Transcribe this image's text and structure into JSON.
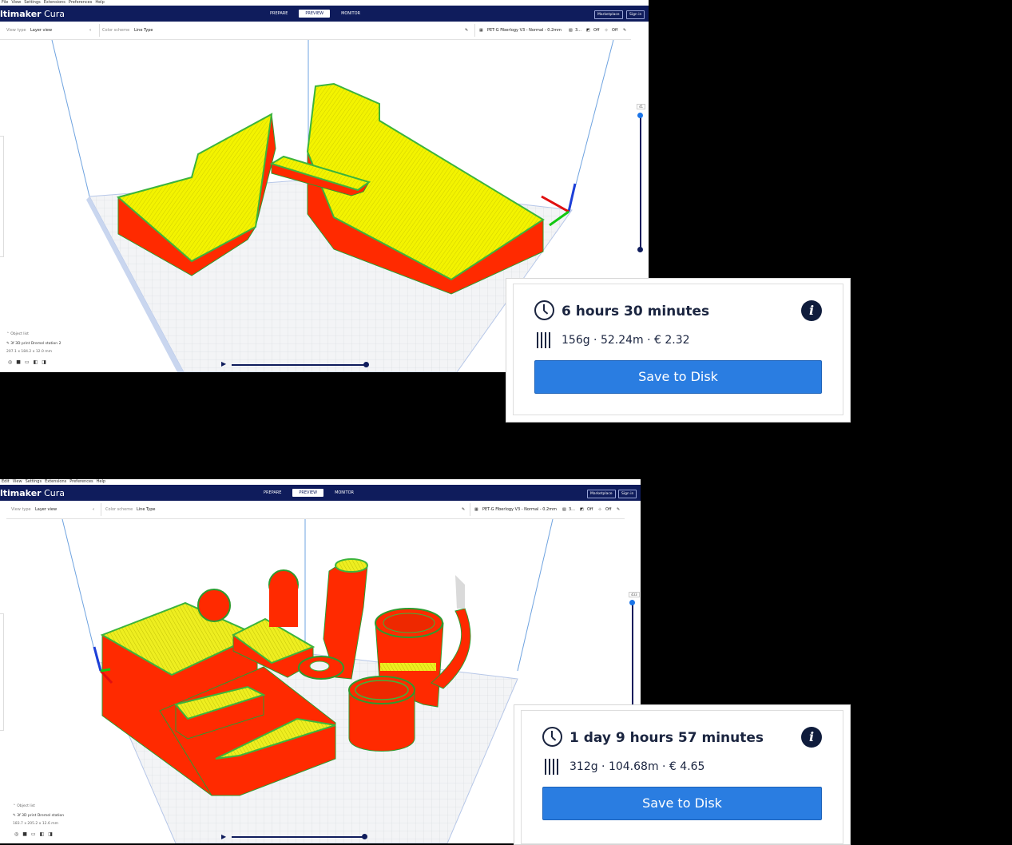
{
  "shots": [
    {
      "menu": [
        "File",
        "View",
        "Settings",
        "Extensions",
        "Preferences",
        "Help"
      ],
      "brand_bold": "ltimaker",
      "brand_rest": " Cura",
      "stages": [
        "PREPARE",
        "PREVIEW",
        "MONITOR"
      ],
      "active_stage": "PREVIEW",
      "marketplace_label": "Marketplace",
      "signin_label": "Sign in",
      "view_type_label": "View type",
      "view_type_value": "Layer view",
      "color_scheme_label": "Color scheme",
      "color_scheme_value": "Line Type",
      "print_setup": "PET-G Fiberlogy V3 - Normal - 0.2mm",
      "support_value": "3...",
      "adhesion1": "Off",
      "adhesion2": "Off",
      "layer_number": "41",
      "object_list_label": "Object list",
      "printer_name": "3f 3D print Dremel station 2",
      "dimensions": "207.1 x 184.2 x 12.0 mm"
    },
    {
      "menu": [
        "Edit",
        "View",
        "Settings",
        "Extensions",
        "Preferences",
        "Help"
      ],
      "brand_bold": "ltimaker",
      "brand_rest": " Cura",
      "stages": [
        "PREPARE",
        "PREVIEW",
        "MONITOR"
      ],
      "active_stage": "PREVIEW",
      "marketplace_label": "Marketplace",
      "signin_label": "Sign in",
      "view_type_label": "View type",
      "view_type_value": "Layer view",
      "color_scheme_label": "Color scheme",
      "color_scheme_value": "Line Type",
      "print_setup": "PET-G Fiberlogy V3 - Normal - 0.2mm",
      "support_value": "3...",
      "adhesion1": "Off",
      "adhesion2": "Off",
      "layer_number": "433",
      "object_list_label": "Object list",
      "printer_name": "3f 3D print Dremel station",
      "dimensions": "183.7 x 205.2 x 12.6 mm"
    }
  ],
  "panels": [
    {
      "time": "6 hours 30 minutes",
      "stats": "156g · 52.24m · € 2.32",
      "save_label": "Save to Disk"
    },
    {
      "time": "1 day 9 hours 57 minutes",
      "stats": "312g · 104.68m · € 4.65",
      "save_label": "Save to Disk"
    }
  ],
  "colors": {
    "header": "#0f1c5c",
    "accent": "#2a7de1",
    "wall": "#ff2a00",
    "infill": "#f2f200",
    "skin_edge": "#3cb43c"
  }
}
